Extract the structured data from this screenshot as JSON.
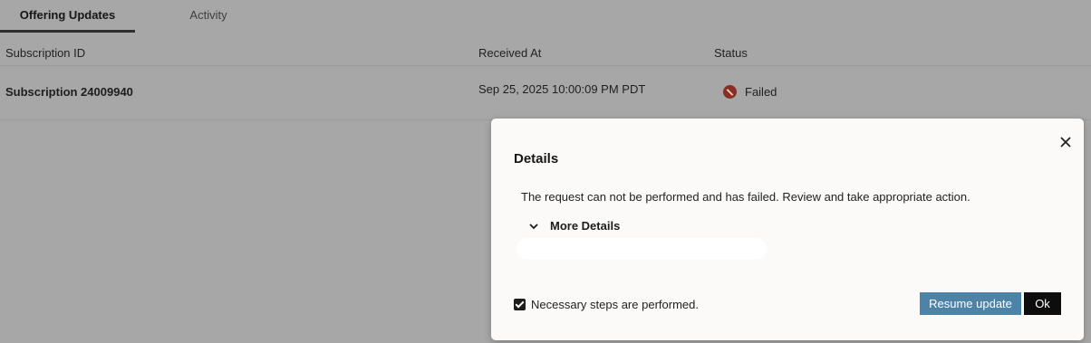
{
  "tabs": [
    {
      "label": "Offering Updates",
      "active": true
    },
    {
      "label": "Activity",
      "active": false
    }
  ],
  "table": {
    "columns": [
      "Subscription ID",
      "Received At",
      "Status"
    ],
    "rows": [
      {
        "subscription": "Subscription 24009940",
        "received_at": "Sep 25, 2025 10:00:09 PM PDT",
        "status": "Failed"
      }
    ]
  },
  "dialog": {
    "title": "Details",
    "message": "The request can not be performed and has failed. Review and take appropriate action.",
    "more_details": "More Details",
    "checkbox_label": "Necessary steps are performed.",
    "checkbox_checked": true,
    "resume_label": "Resume update",
    "ok_label": "Ok"
  },
  "colors": {
    "overlay": "#a7a7a7",
    "dialog_bg": "#fbfaf9",
    "resume_button": "#4e83a8",
    "ok_button": "#0d0d0d",
    "failed_icon": "#8a2e24"
  },
  "icons": {
    "close": "close-icon",
    "chevron": "chevron-down-icon",
    "status": "failed-status-icon",
    "checkbox": "checkbox-checked-icon"
  }
}
